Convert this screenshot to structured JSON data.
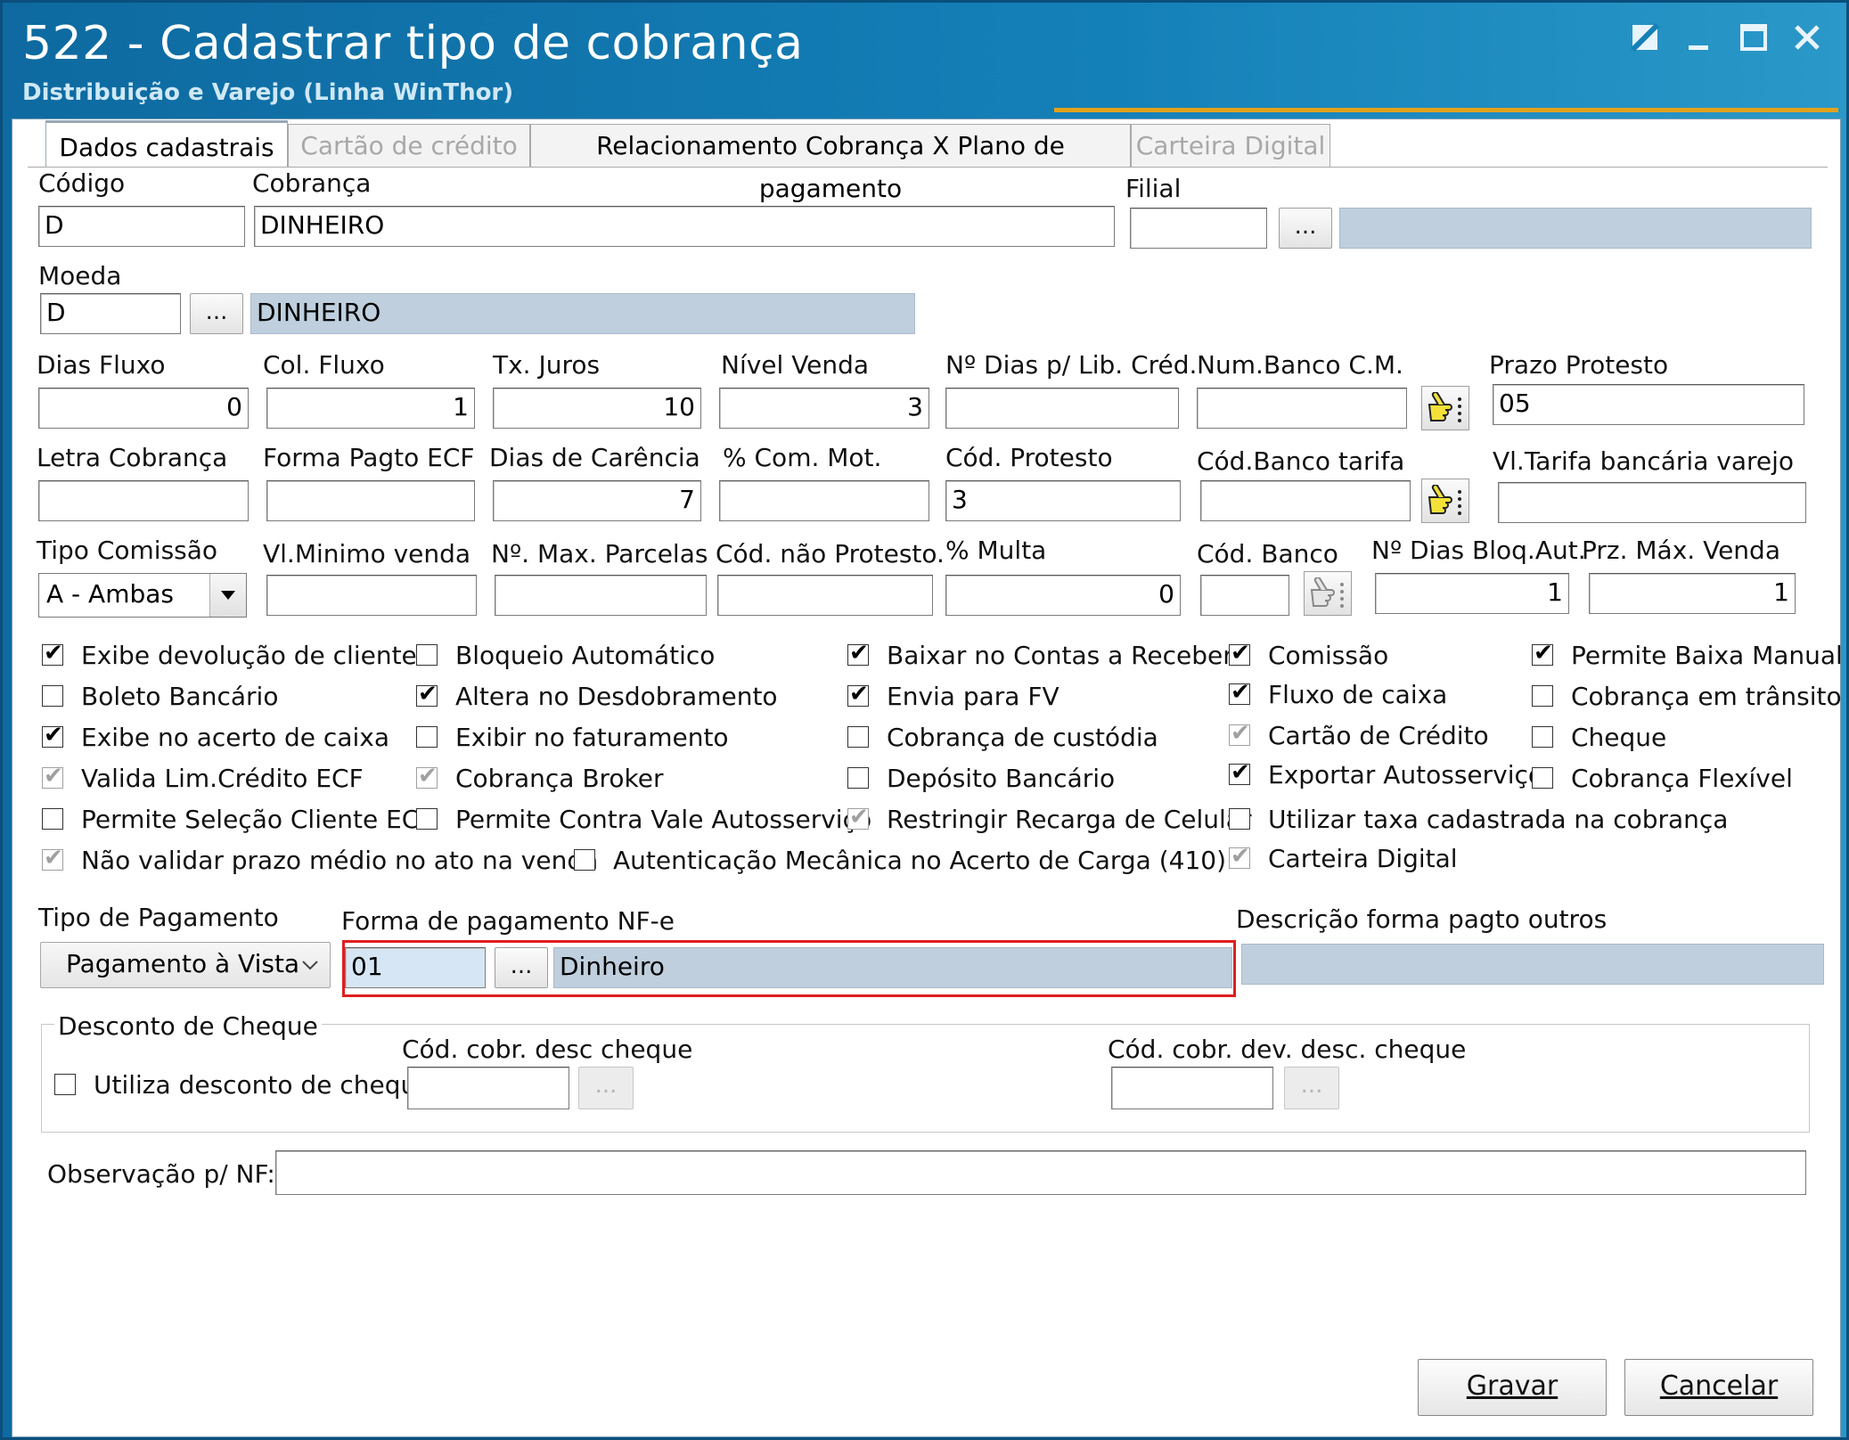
{
  "window": {
    "title": "522 - Cadastrar tipo de cobrança",
    "subtitle": "Distribuição e Varejo (Linha WinThor)"
  },
  "tabs": [
    {
      "label": "Dados cadastrais",
      "state": "active"
    },
    {
      "label": "Cartão de crédito",
      "state": "disabled"
    },
    {
      "label": "Relacionamento Cobrança X Plano de pagamento",
      "state": "normal"
    },
    {
      "label": "Carteira Digital",
      "state": "disabled"
    }
  ],
  "fields": {
    "codigo": {
      "label": "Código",
      "value": "D"
    },
    "cobranca": {
      "label": "Cobrança",
      "value": "DINHEIRO"
    },
    "filial": {
      "label": "Filial",
      "value": ""
    },
    "moeda": {
      "label": "Moeda",
      "value": "D",
      "desc": "DINHEIRO"
    },
    "dias_fluxo": {
      "label": "Dias Fluxo",
      "value": "0"
    },
    "col_fluxo": {
      "label": "Col. Fluxo",
      "value": "1"
    },
    "tx_juros": {
      "label": "Tx. Juros",
      "value": "10"
    },
    "nivel_venda": {
      "label": "Nível Venda",
      "value": "3"
    },
    "dias_lib_cred": {
      "label": "Nº Dias p/ Lib. Créd.",
      "value": ""
    },
    "num_banco_cm": {
      "label": "Num.Banco C.M.",
      "value": ""
    },
    "prazo_protesto": {
      "label": "Prazo Protesto",
      "value": "05"
    },
    "letra_cobranca": {
      "label": "Letra Cobrança",
      "value": ""
    },
    "forma_pagto_ecf": {
      "label": "Forma Pagto ECF",
      "value": ""
    },
    "dias_carencia": {
      "label": "Dias de Carência",
      "value": "7"
    },
    "com_mot": {
      "label": "% Com. Mot.",
      "value": ""
    },
    "cod_protesto": {
      "label": "Cód. Protesto",
      "value": "3"
    },
    "cod_banco_tarifa": {
      "label": "Cód.Banco tarifa",
      "value": ""
    },
    "vl_tarifa": {
      "label": "Vl.Tarifa bancária varejo",
      "value": ""
    },
    "tipo_comissao": {
      "label": "Tipo Comissão",
      "value": "A - Ambas"
    },
    "vl_minimo": {
      "label": "Vl.Minimo venda",
      "value": ""
    },
    "max_parcelas": {
      "label": "Nº. Max. Parcelas",
      "value": ""
    },
    "cod_nao_protesto": {
      "label": "Cód. não Protesto.",
      "value": ""
    },
    "multa": {
      "label": "% Multa",
      "value": "0"
    },
    "cod_banco": {
      "label": "Cód. Banco",
      "value": ""
    },
    "dias_bloq": {
      "label": "Nº Dias Bloq.Aut.",
      "value": "1"
    },
    "prz_max_venda": {
      "label": "Prz. Máx. Venda",
      "value": "1"
    }
  },
  "checkboxes": [
    {
      "label": "Exibe devolução de cliente",
      "checked": true,
      "disabled": false
    },
    {
      "label": "Boleto Bancário",
      "checked": false,
      "disabled": false
    },
    {
      "label": "Exibe no acerto de caixa",
      "checked": true,
      "disabled": false
    },
    {
      "label": "Valida Lim.Crédito ECF",
      "checked": true,
      "disabled": true
    },
    {
      "label": "Permite Seleção Cliente ECF",
      "checked": false,
      "disabled": false
    },
    {
      "label": "Não validar prazo médio no ato na venda",
      "checked": true,
      "disabled": true
    },
    {
      "label": "Bloqueio Automático",
      "checked": false,
      "disabled": false
    },
    {
      "label": "Altera no Desdobramento",
      "checked": true,
      "disabled": false
    },
    {
      "label": "Exibir no faturamento",
      "checked": false,
      "disabled": false
    },
    {
      "label": "Cobrança Broker",
      "checked": true,
      "disabled": true
    },
    {
      "label": "Permite Contra Vale Autosserviço",
      "checked": false,
      "disabled": false
    },
    {
      "label": "Autenticação Mecânica no Acerto de Carga (410)",
      "checked": false,
      "disabled": false
    },
    {
      "label": "Baixar no Contas a Receber",
      "checked": true,
      "disabled": false
    },
    {
      "label": "Envia para FV",
      "checked": true,
      "disabled": false
    },
    {
      "label": "Cobrança de custódia",
      "checked": false,
      "disabled": false
    },
    {
      "label": "Depósito Bancário",
      "checked": false,
      "disabled": false
    },
    {
      "label": "Restringir Recarga de Celular",
      "checked": true,
      "disabled": true
    },
    {
      "label": "Comissão",
      "checked": true,
      "disabled": false
    },
    {
      "label": "Fluxo de caixa",
      "checked": true,
      "disabled": false
    },
    {
      "label": "Cartão de Crédito",
      "checked": true,
      "disabled": true
    },
    {
      "label": "Exportar Autosserviço",
      "checked": true,
      "disabled": false
    },
    {
      "label": "Utilizar taxa cadastrada na cobrança",
      "checked": false,
      "disabled": false
    },
    {
      "label": "Carteira Digital",
      "checked": true,
      "disabled": true
    },
    {
      "label": "Permite Baixa Manual",
      "checked": true,
      "disabled": false
    },
    {
      "label": "Cobrança em trânsito",
      "checked": false,
      "disabled": false
    },
    {
      "label": "Cheque",
      "checked": false,
      "disabled": false
    },
    {
      "label": "Cobrança Flexível",
      "checked": false,
      "disabled": false
    }
  ],
  "pagamento": {
    "tipo_label": "Tipo de Pagamento",
    "tipo_value": "Pagamento à Vista",
    "forma_label": "Forma de pagamento NF-e",
    "forma_code": "01",
    "forma_desc": "Dinheiro",
    "desc_outros_label": "Descrição forma pagto outros",
    "desc_outros_value": ""
  },
  "desconto_cheque": {
    "group_label": "Desconto de Cheque",
    "utiliza_label": "Utiliza desconto de cheque",
    "utiliza_checked": false,
    "cod_cobr_label": "Cód. cobr. desc cheque",
    "cod_cobr_value": "",
    "cod_dev_label": "Cód. cobr. dev. desc. cheque",
    "cod_dev_value": ""
  },
  "observacao": {
    "label": "Observação p/ NF:",
    "value": ""
  },
  "buttons": {
    "ellipsis": "...",
    "gravar": "Gravar",
    "cancelar": "Cancelar"
  }
}
